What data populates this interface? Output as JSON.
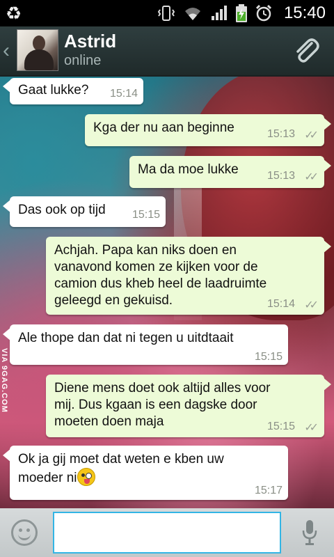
{
  "status_bar": {
    "time": "15:40",
    "icons": [
      "recycle-icon",
      "vibrate-icon",
      "wifi-icon",
      "signal-icon",
      "battery-charging-icon",
      "alarm-icon"
    ]
  },
  "header": {
    "contact_name": "Astrid",
    "contact_status": "online",
    "icons": [
      "back-chevron-icon",
      "attach-paperclip-icon"
    ]
  },
  "messages": [
    {
      "direction": "in",
      "text": "Gaat lukke?",
      "time": "15:14"
    },
    {
      "direction": "out",
      "text": "Kga der nu aan beginne",
      "time": "15:13",
      "ticks": "✓✓"
    },
    {
      "direction": "out",
      "text": "Ma da moe lukke",
      "time": "15:13",
      "ticks": "✓✓"
    },
    {
      "direction": "in",
      "text": "Das ook op tijd",
      "time": "15:15"
    },
    {
      "direction": "out",
      "text": "Achjah. Papa kan niks doen en\nvanavond komen ze kijken voor de\ncamion dus kheb heel de laadruimte\ngeleegd en gekuisd.",
      "time": "15:14",
      "ticks": "✓✓"
    },
    {
      "direction": "in",
      "text": "Ale thope dan dat ni tegen u uitdtaait",
      "time": "15:15"
    },
    {
      "direction": "out",
      "text": "Diene mens doet ook altijd alles voor\nmij. Dus kgaan is een dagske door\nmoeten doen maja",
      "time": "15:15",
      "ticks": "✓✓"
    },
    {
      "direction": "in",
      "text": "Ok ja gij moet dat weten e kben uw\nmoeder ni",
      "time": "15:17",
      "emoji": "winking-tongue-emoji"
    }
  ],
  "watermark": "VIA 9GAG.COM",
  "composer": {
    "value": "",
    "icons": [
      "smiley-icon",
      "microphone-icon"
    ]
  }
}
